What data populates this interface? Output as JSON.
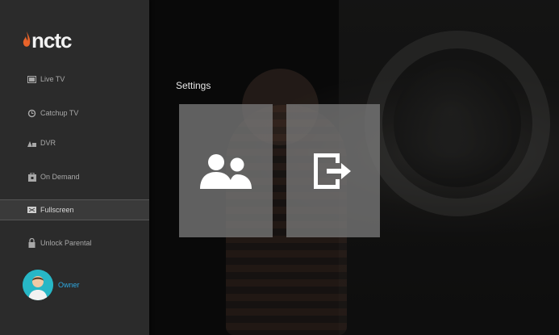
{
  "sidebar": {
    "logo_text": "nctc",
    "items": [
      {
        "label": "Live TV",
        "icon": "tv-icon"
      },
      {
        "label": "Catchup TV",
        "icon": "rewind-clock-icon"
      },
      {
        "label": "DVR",
        "icon": "dvr-icon"
      },
      {
        "label": "On Demand",
        "icon": "video-store-icon"
      },
      {
        "label": "Fullscreen",
        "icon": "fullscreen-icon",
        "active": true
      },
      {
        "label": "Unlock Parental",
        "icon": "lock-icon"
      }
    ],
    "user_name": "Owner"
  },
  "main": {
    "title": "Settings",
    "tiles": [
      {
        "icon": "users-icon"
      },
      {
        "icon": "exit-icon"
      }
    ]
  },
  "colors": {
    "sidebar_bg": "#2b2b2b",
    "tile_bg": "#787878",
    "accent": "#2ea8e0",
    "logo_flame": "#e8632a"
  }
}
